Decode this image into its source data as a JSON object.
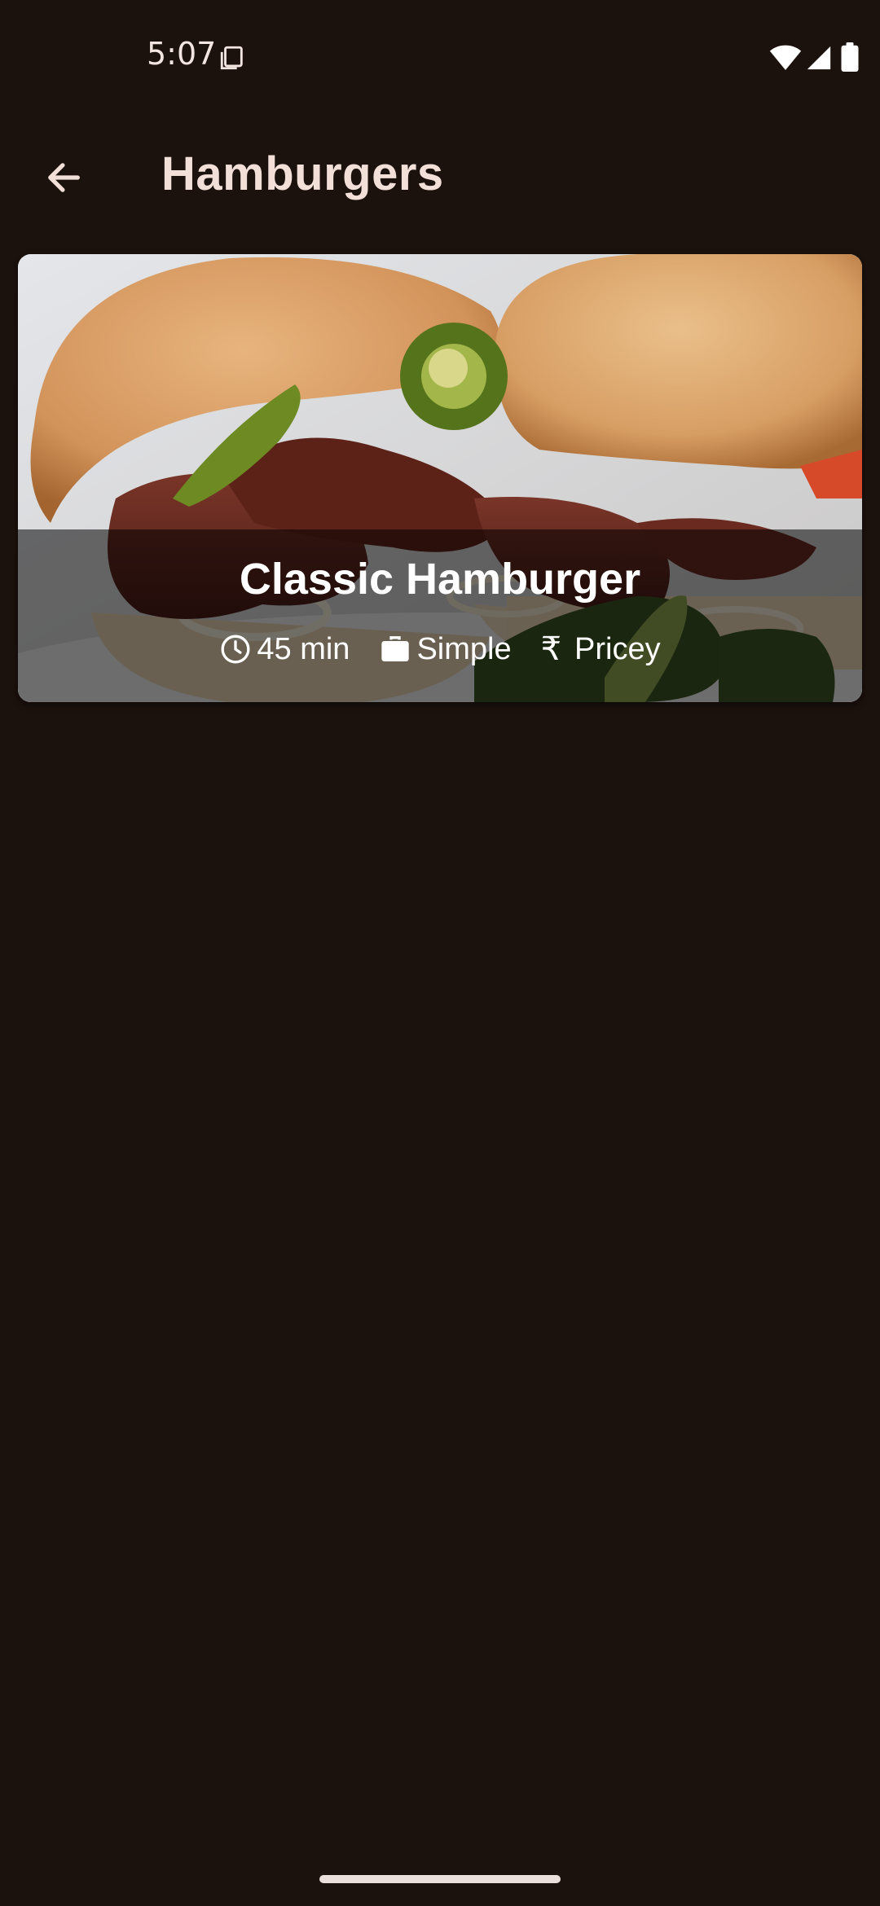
{
  "status_bar": {
    "time": "5:07",
    "icons": [
      "screenshot-icon",
      "wifi-icon",
      "signal-icon",
      "battery-icon"
    ]
  },
  "app_bar": {
    "back_icon": "arrow-back-icon",
    "title": "Hamburgers"
  },
  "meal": {
    "title": "Classic Hamburger",
    "duration": "45 min",
    "complexity": "Simple",
    "affordability": "Pricey",
    "icons": {
      "duration": "clock-icon",
      "complexity": "work-bag-icon",
      "affordability": "rupee-icon"
    }
  },
  "colors": {
    "background": "#1b110d",
    "on_background": "#f1dfd8",
    "overlay": "rgba(0,0,0,0.54)"
  }
}
